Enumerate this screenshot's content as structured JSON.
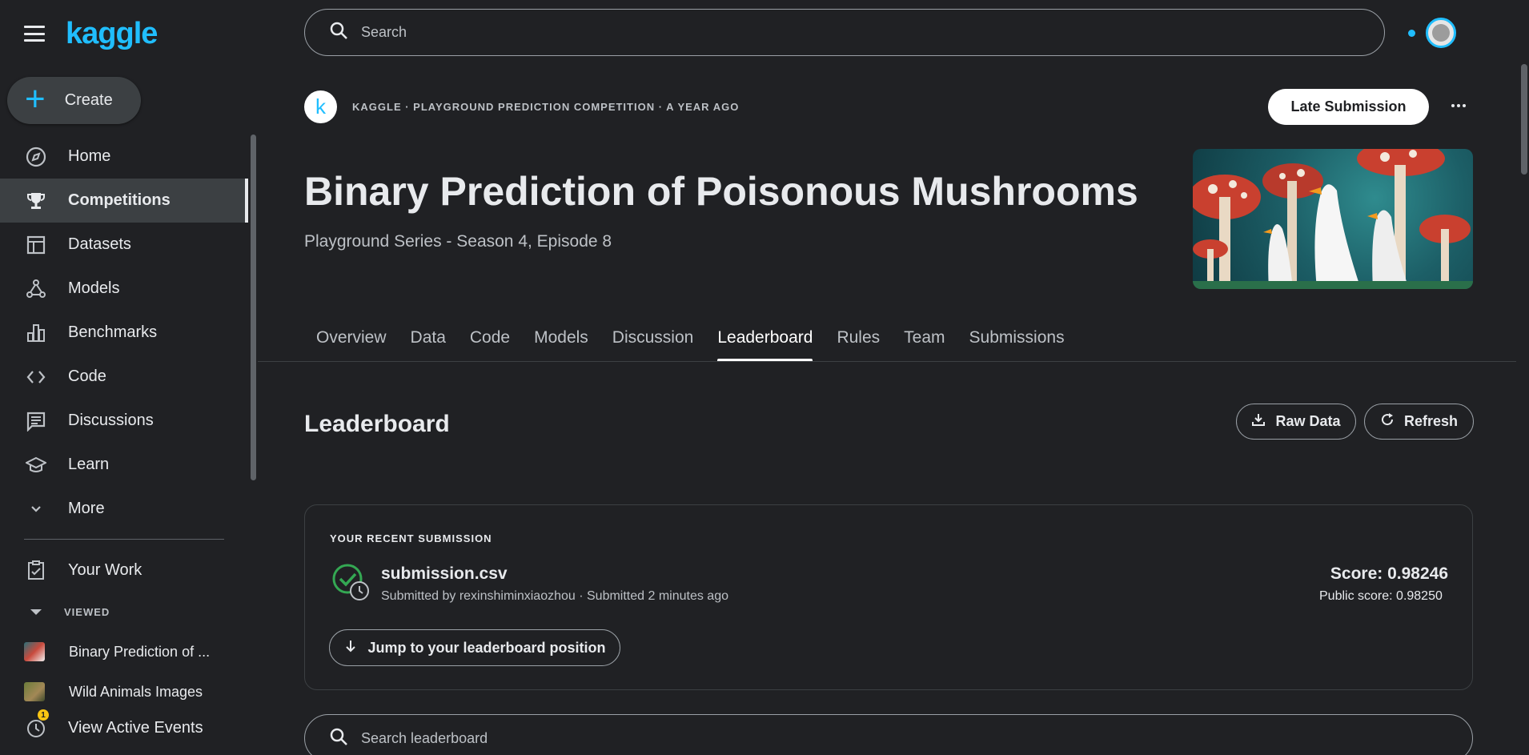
{
  "brand": {
    "logo_text": "kaggle"
  },
  "sidebar": {
    "create_label": "Create",
    "items": [
      {
        "label": "Home",
        "icon": "compass-icon"
      },
      {
        "label": "Competitions",
        "icon": "trophy-icon",
        "active": true
      },
      {
        "label": "Datasets",
        "icon": "table-icon"
      },
      {
        "label": "Models",
        "icon": "models-icon"
      },
      {
        "label": "Benchmarks",
        "icon": "bar-chart-icon"
      },
      {
        "label": "Code",
        "icon": "code-icon"
      },
      {
        "label": "Discussions",
        "icon": "comment-icon"
      },
      {
        "label": "Learn",
        "icon": "school-icon"
      },
      {
        "label": "More",
        "icon": "chevron-down-icon"
      }
    ],
    "your_work": "Your Work",
    "viewed_label": "VIEWED",
    "viewed": [
      {
        "label": "Binary Prediction of ..."
      },
      {
        "label": "Wild Animals Images"
      }
    ],
    "events_label": "View Active Events",
    "events_count": "1"
  },
  "topbar": {
    "search_placeholder": "Search"
  },
  "competition": {
    "host_initial": "k",
    "meta": "KAGGLE · PLAYGROUND PREDICTION COMPETITION · A YEAR AGO",
    "late_submission_label": "Late Submission",
    "title": "Binary Prediction of Poisonous Mushrooms",
    "subtitle": "Playground Series - Season 4, Episode 8"
  },
  "tabs": [
    {
      "label": "Overview"
    },
    {
      "label": "Data"
    },
    {
      "label": "Code"
    },
    {
      "label": "Models"
    },
    {
      "label": "Discussion"
    },
    {
      "label": "Leaderboard",
      "active": true
    },
    {
      "label": "Rules"
    },
    {
      "label": "Team"
    },
    {
      "label": "Submissions"
    }
  ],
  "leaderboard": {
    "title": "Leaderboard",
    "raw_data_label": "Raw Data",
    "refresh_label": "Refresh",
    "recent": {
      "label": "YOUR RECENT SUBMISSION",
      "file_name": "submission.csv",
      "meta": "Submitted by rexinshiminxiaozhou · Submitted 2 minutes ago",
      "score": "Score: 0.98246",
      "public_score": "Public score: 0.98250",
      "jump_label": "Jump to your leaderboard position"
    },
    "search_placeholder": "Search leaderboard"
  },
  "colors": {
    "accent": "#20beff",
    "background": "#202124",
    "success": "#34a853"
  }
}
